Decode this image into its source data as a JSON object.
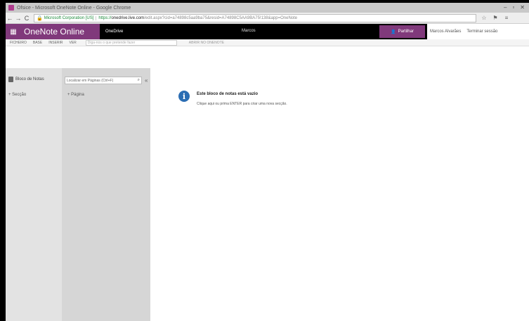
{
  "browser": {
    "tab_title": "Ofsice - Microsoft OneNote Online - Google Chrome",
    "window_controls": [
      "–",
      "▫",
      "✕"
    ],
    "nav": [
      "←",
      "→",
      "C"
    ],
    "ssl_label": "Microsoft Corporation [US]",
    "scheme": "https://",
    "host": "onedrive.live.com",
    "url_rest": "/edit.aspx?cid=a74898c5aa9ba75&resid=A74898C5AA9BA75!138&app=OneNote",
    "extensions": [
      "☆",
      "⚑",
      "≡"
    ]
  },
  "app": {
    "grid_icon": "▦",
    "brand": "OneNote Online",
    "breadcrumb": "OneDrive",
    "notebook": "Marcos",
    "share_label": "Partilhar",
    "header_links": [
      "Marcos Alvarães",
      "Terminar sessão"
    ]
  },
  "ribbon": {
    "tabs": [
      "FICHEIRO",
      "BASE",
      "INSERIR",
      "VER"
    ],
    "tell_me": "Diga-nos o que pretende fazer",
    "edit_mode": "ABRIR NO ONENOTE"
  },
  "nav_pane": {
    "back_label": "Bloco de Notas",
    "pages_search_placeholder": "Localizar em Páginas (Ctrl+F)",
    "collapse": "«",
    "add_section": "+ Secção",
    "add_page": "+ Página"
  },
  "content": {
    "info_icon": "i",
    "title": "Este bloco de notas está vazio",
    "body": "Clique aqui ou prima ENTER para criar uma nova secção."
  }
}
